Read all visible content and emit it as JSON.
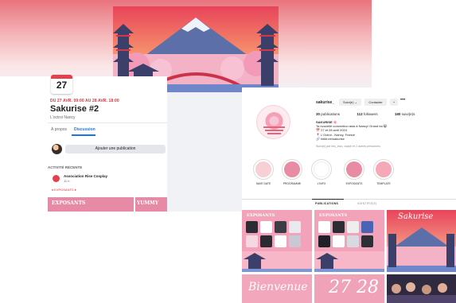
{
  "facebook_event": {
    "date_badge": "27",
    "date_range": "DU 27 AVR. 09:00 AU 28 AVR. 18:00",
    "title": "Sakurise #2",
    "location": "L'octroi Nancy",
    "tabs": [
      "À propos",
      "Discussion"
    ],
    "post_button": "Ajouter une publication",
    "activity_heading": "ACTIVITÉ RÉCENTE",
    "activity": {
      "name": "Association Rise Cosplay",
      "time": "11 h · ",
      "tag": "♦ EXPOSANTS ♦"
    },
    "bottom_left": "EXPOSANTS",
    "bottom_right": "YUMMY"
  },
  "instagram": {
    "username": "sakurise_",
    "buttons": [
      "Suivi(e) ⌄",
      "Contacter",
      "+"
    ],
    "more": "•••",
    "stats": [
      {
        "value": "30",
        "label": "publications"
      },
      {
        "value": "112",
        "label": "followers"
      },
      {
        "value": "180",
        "label": "suivi(e)s"
      }
    ],
    "bio": {
      "name": "SAKURISE 🌸",
      "lines": [
        "Ta nouvelle convention asia à Nancy! Grand fai 😸",
        "📅 27 et 28 avril 2024",
        "📍 L'Octroi - Nancy, France",
        "🔗 linktr.ee/sakurise"
      ]
    },
    "followed_by": "Suivi(e) par lies_inso, osdpb et 2 autres personnes",
    "highlights": [
      {
        "label": "SAVE DATE",
        "color": "#f7d0d6"
      },
      {
        "label": "PROGRAMME",
        "color": "#e98ba3"
      },
      {
        "label": "L'INFO",
        "color": "#ffffff"
      },
      {
        "label": "EXPOSANTS",
        "color": "#e98ba3"
      },
      {
        "label": "TEMPLATE",
        "color": "#f4a8b8"
      }
    ],
    "tabs": [
      "PUBLICATIONS",
      "IDENTIFIÉ(E)"
    ],
    "tiles": {
      "t1": "EXPOSANTS",
      "t2": "EXPOSANTS",
      "t3": "Sakurise",
      "t4": "27 28",
      "t5": "Bienvenue"
    }
  },
  "colors": {
    "fb_blue": "#1b74e4",
    "fb_red": "#e4404e",
    "brand_pink": "#e78aa6",
    "sunset_top": "#e9737d"
  }
}
